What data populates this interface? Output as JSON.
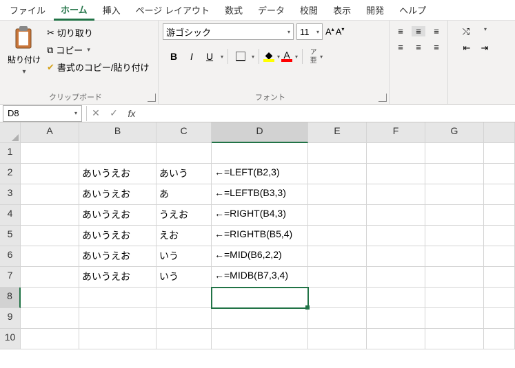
{
  "menu": {
    "items": [
      "ファイル",
      "ホーム",
      "挿入",
      "ページ レイアウト",
      "数式",
      "データ",
      "校閲",
      "表示",
      "開発",
      "ヘルプ"
    ],
    "active": 1
  },
  "ribbon": {
    "clipboard": {
      "paste": "貼り付け",
      "cut": "切り取り",
      "copy": "コピー",
      "format_painter": "書式のコピー/貼り付け",
      "label": "クリップボード"
    },
    "font": {
      "name": "游ゴシック",
      "size": "11",
      "label": "フォント",
      "ruby": "ア亜"
    }
  },
  "namebox": "D8",
  "formula": "",
  "cols": [
    "A",
    "B",
    "C",
    "D",
    "E",
    "F",
    "G",
    ""
  ],
  "rows": {
    "r1": {
      "B": "",
      "C": "",
      "D": ""
    },
    "r2": {
      "B": "あいうえお",
      "C": "あいう",
      "D": "←=LEFT(B2,3)"
    },
    "r3": {
      "B": "あいうえお",
      "C": "あ",
      "D": "←=LEFTB(B3,3)"
    },
    "r4": {
      "B": "あいうえお",
      "C": "うえお",
      "D": "←=RIGHT(B4,3)"
    },
    "r5": {
      "B": "あいうえお",
      "C": "えお",
      "D": "←=RIGHTB(B5,4)"
    },
    "r6": {
      "B": "あいうえお",
      "C": "いう",
      "D": "←=MID(B6,2,2)"
    },
    "r7": {
      "B": "あいうえお",
      "C": "いう",
      "D": "←=MIDB(B7,3,4)"
    }
  },
  "rownums": [
    "1",
    "2",
    "3",
    "4",
    "5",
    "6",
    "7",
    "8",
    "9",
    "10"
  ]
}
